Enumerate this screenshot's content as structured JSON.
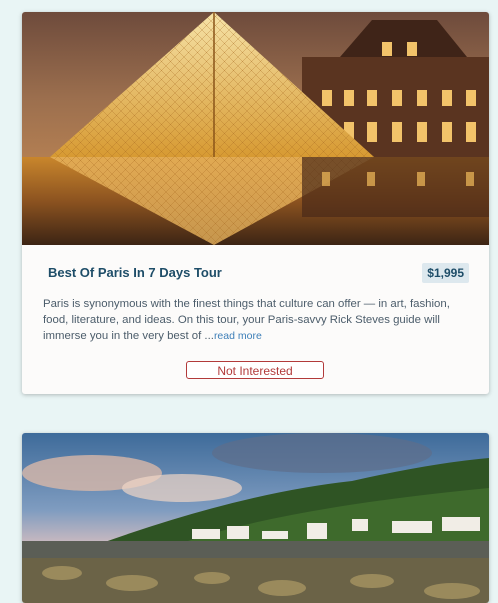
{
  "tours": [
    {
      "title": "Best Of Paris In 7 Days Tour",
      "price": "$1,995",
      "description": "Paris is synonymous with the finest things that culture can offer — in art, fashion, food, literature, and ideas. On this tour, your Paris-savvy Rick Steves guide will immerse you in the very best of ...",
      "read_more_label": "read more",
      "not_interested_label": "Not Interested"
    }
  ]
}
